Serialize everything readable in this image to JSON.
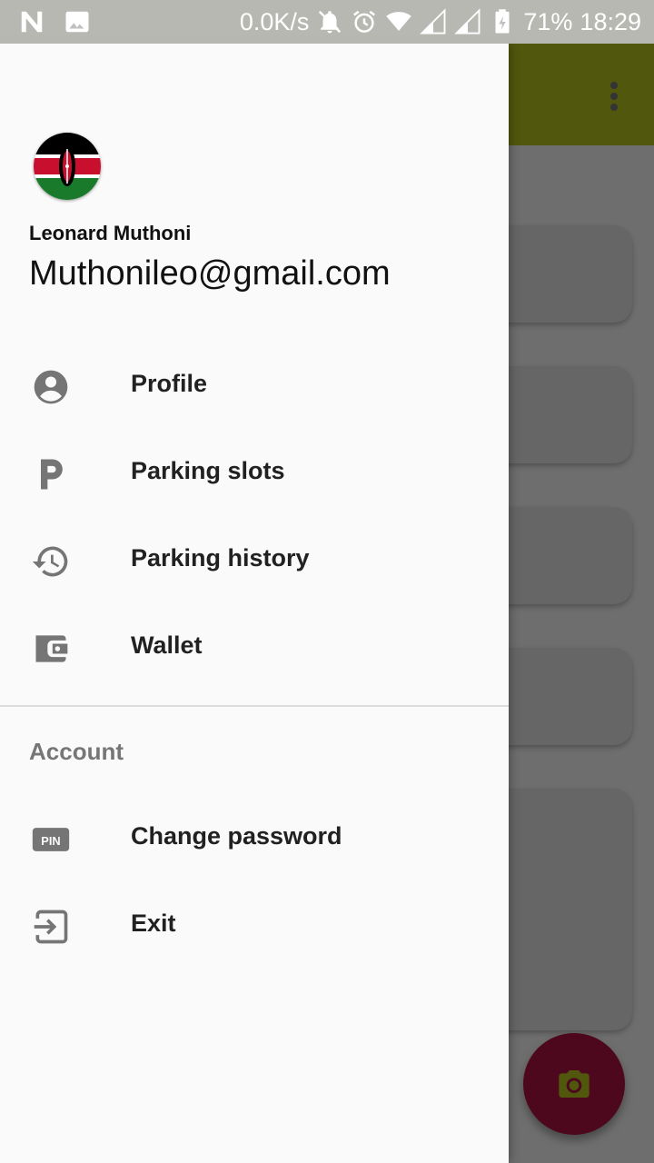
{
  "status_bar": {
    "net_speed": "0.0K/s",
    "battery": "71%",
    "time": "18:29"
  },
  "drawer": {
    "user_name": "Leonard Muthoni",
    "user_email": "Muthonileo@gmail.com",
    "items": [
      {
        "label": "Profile",
        "icon": "account-circle-icon"
      },
      {
        "label": "Parking slots",
        "icon": "parking-icon"
      },
      {
        "label": "Parking history",
        "icon": "history-icon"
      },
      {
        "label": "Wallet",
        "icon": "wallet-icon"
      }
    ],
    "section_title": "Account",
    "account_items": [
      {
        "label": "Change password",
        "icon": "pin-icon"
      },
      {
        "label": "Exit",
        "icon": "exit-icon"
      }
    ]
  },
  "colors": {
    "toolbar": "#b8c61e",
    "fab": "#b01446",
    "icon": "#757575"
  }
}
